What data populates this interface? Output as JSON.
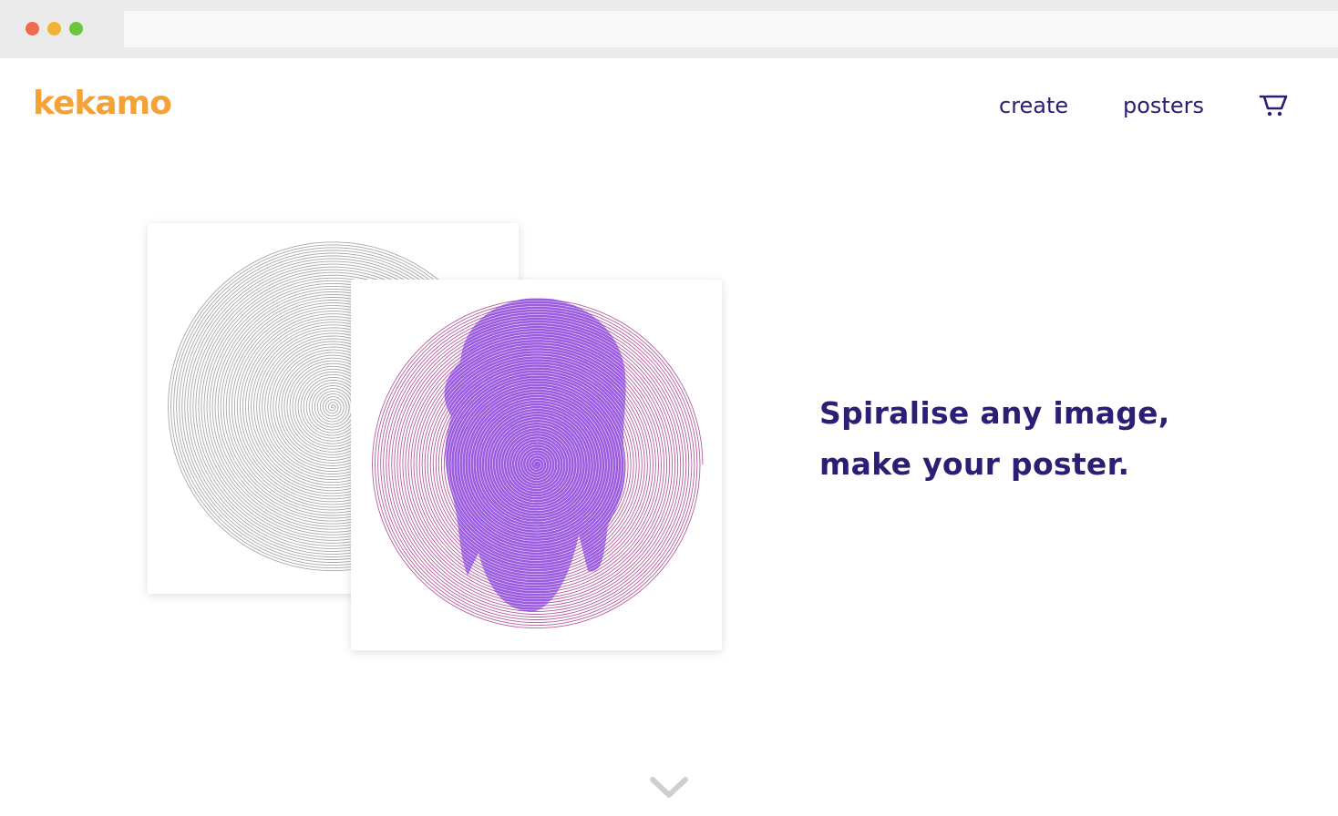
{
  "browser": {
    "address_value": "",
    "controls": [
      "close",
      "minimize",
      "maximize"
    ]
  },
  "header": {
    "logo": "kekamo",
    "nav": [
      {
        "label": "create"
      },
      {
        "label": "posters"
      }
    ],
    "cart_icon": "cart-icon"
  },
  "hero": {
    "headline_line1": "Spiralise any image,",
    "headline_line2": "make your poster."
  },
  "icons": {
    "scroll": "chevron-down-icon"
  },
  "colors": {
    "brand": "#f4a236",
    "text": "#2b1f73",
    "spiral_gray": "#a8a8a8",
    "spiral_purple": "#9b5ce0",
    "spiral_pink": "#b65a9e"
  }
}
